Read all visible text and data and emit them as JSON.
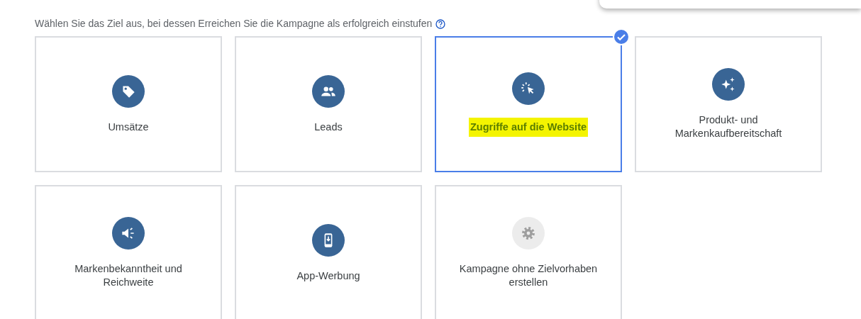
{
  "prompt": "Wählen Sie das Ziel aus, bei dessen Erreichen Sie die Kampagne als erfolgreich einstufen",
  "goals": [
    {
      "kind": "tag",
      "label": "Umsätze",
      "selected": false,
      "highlighted": false,
      "muted": false
    },
    {
      "kind": "people",
      "label": "Leads",
      "selected": false,
      "highlighted": false,
      "muted": false
    },
    {
      "kind": "click",
      "label": "Zugriffe auf die Website",
      "selected": true,
      "highlighted": true,
      "muted": false
    },
    {
      "kind": "sparkle",
      "label": "Produkt- und Markenkaufbereitschaft",
      "selected": false,
      "highlighted": false,
      "muted": false
    },
    {
      "kind": "megaphone",
      "label": "Markenbekanntheit und Reichweite",
      "selected": false,
      "highlighted": false,
      "muted": false
    },
    {
      "kind": "phone",
      "label": "App-Werbung",
      "selected": false,
      "highlighted": false,
      "muted": false
    },
    {
      "kind": "gear",
      "label": "Kampagne ohne Zielvorhaben erstellen",
      "selected": false,
      "highlighted": false,
      "muted": true
    }
  ]
}
